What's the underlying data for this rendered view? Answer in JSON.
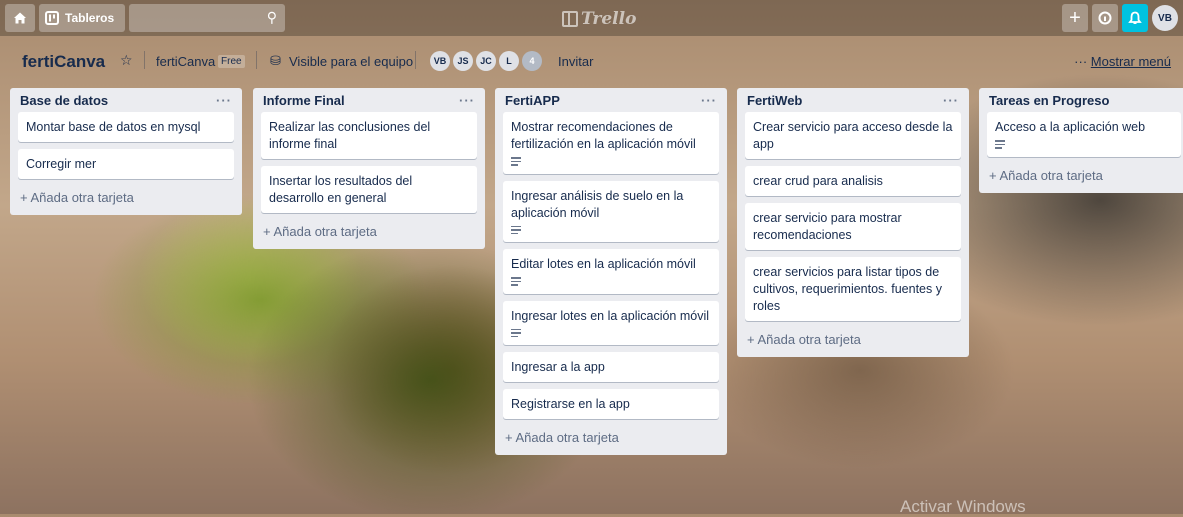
{
  "topbar": {
    "home_icon": "home-icon",
    "boards_label": "Tableros",
    "search_placeholder": "",
    "logo": "Trello",
    "avatar_initials": "VB"
  },
  "board": {
    "title": "fertiCanva",
    "team": "fertiCanva",
    "plan": "Free",
    "visibility": "Visible para el equipo",
    "members": [
      "VB",
      "JS",
      "JC",
      "L"
    ],
    "member_count": "4",
    "invite": "Invitar",
    "menu_dots": "···",
    "menu_label": "Mostrar menú"
  },
  "lists": [
    {
      "title": "Base de datos",
      "cards": [
        {
          "text": "Montar base de datos en mysql"
        },
        {
          "text": "Corregir mer"
        }
      ],
      "add": "+ Añada otra tarjeta"
    },
    {
      "title": "Informe Final",
      "cards": [
        {
          "text": "Realizar las conclusiones del informe final"
        },
        {
          "text": "Insertar los resultados del desarrollo en general"
        }
      ],
      "add": "+ Añada otra tarjeta"
    },
    {
      "title": "FertiAPP",
      "cards": [
        {
          "text": "Mostrar recomendaciones de fertilización en la aplicación móvil",
          "desc": true
        },
        {
          "text": "Ingresar análisis de suelo en la aplicación móvil",
          "desc": true
        },
        {
          "text": "Editar lotes en la aplicación móvil",
          "desc": true
        },
        {
          "text": "Ingresar lotes en la aplicación móvil",
          "desc": true
        },
        {
          "text": "Ingresar a la app"
        },
        {
          "text": "Registrarse en la app"
        }
      ],
      "add": "+ Añada otra tarjeta"
    },
    {
      "title": "FertiWeb",
      "cards": [
        {
          "text": "Crear servicio para acceso desde la app"
        },
        {
          "text": "crear crud para analisis"
        },
        {
          "text": "crear servicio para mostrar recomendaciones"
        },
        {
          "text": "crear servicios para listar tipos de cultivos, requerimientos. fuentes y roles"
        }
      ],
      "add": "+ Añada otra tarjeta"
    },
    {
      "title": "Tareas en Progreso",
      "cards": [
        {
          "text": "Acceso a la aplicación web",
          "desc": true
        }
      ],
      "add": "+ Añada otra tarjeta"
    }
  ],
  "watermark": "Activar Windows",
  "colors": {
    "list_bg": "#ebecf0",
    "notification_accent": "#00c2e0",
    "text": "#172b4d"
  }
}
